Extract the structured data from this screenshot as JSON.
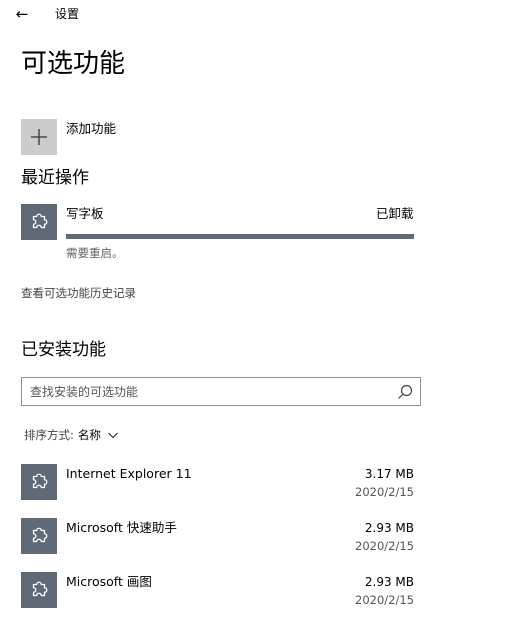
{
  "window": {
    "title": "设置",
    "back_glyph": "←"
  },
  "page": {
    "title": "可选功能"
  },
  "add_feature": {
    "label": "添加功能"
  },
  "recent": {
    "heading": "最近操作",
    "item": {
      "name": "写字板",
      "status": "已卸载",
      "progress": 1.0,
      "note": "需要重启。"
    }
  },
  "history_link": "查看可选功能历史记录",
  "installed": {
    "heading": "已安装功能",
    "search_placeholder": "查找安装的可选功能",
    "sort_label": "排序方式:",
    "sort_value": "名称",
    "features": [
      {
        "name": "Internet Explorer 11",
        "size": "3.17 MB",
        "date": "2020/2/15"
      },
      {
        "name": "Microsoft 快速助手",
        "size": "2.93 MB",
        "date": "2020/2/15"
      },
      {
        "name": "Microsoft 画图",
        "size": "2.93 MB",
        "date": "2020/2/15"
      }
    ]
  },
  "colors": {
    "tile": "#5e6b77",
    "add_tile": "#cccccc",
    "progress_track": "#e6e6e6"
  },
  "icons": {
    "feature": "puzzle-icon",
    "add": "plus-icon",
    "search": "search-icon",
    "sort": "chevron-down-icon",
    "back": "back-arrow-icon"
  }
}
